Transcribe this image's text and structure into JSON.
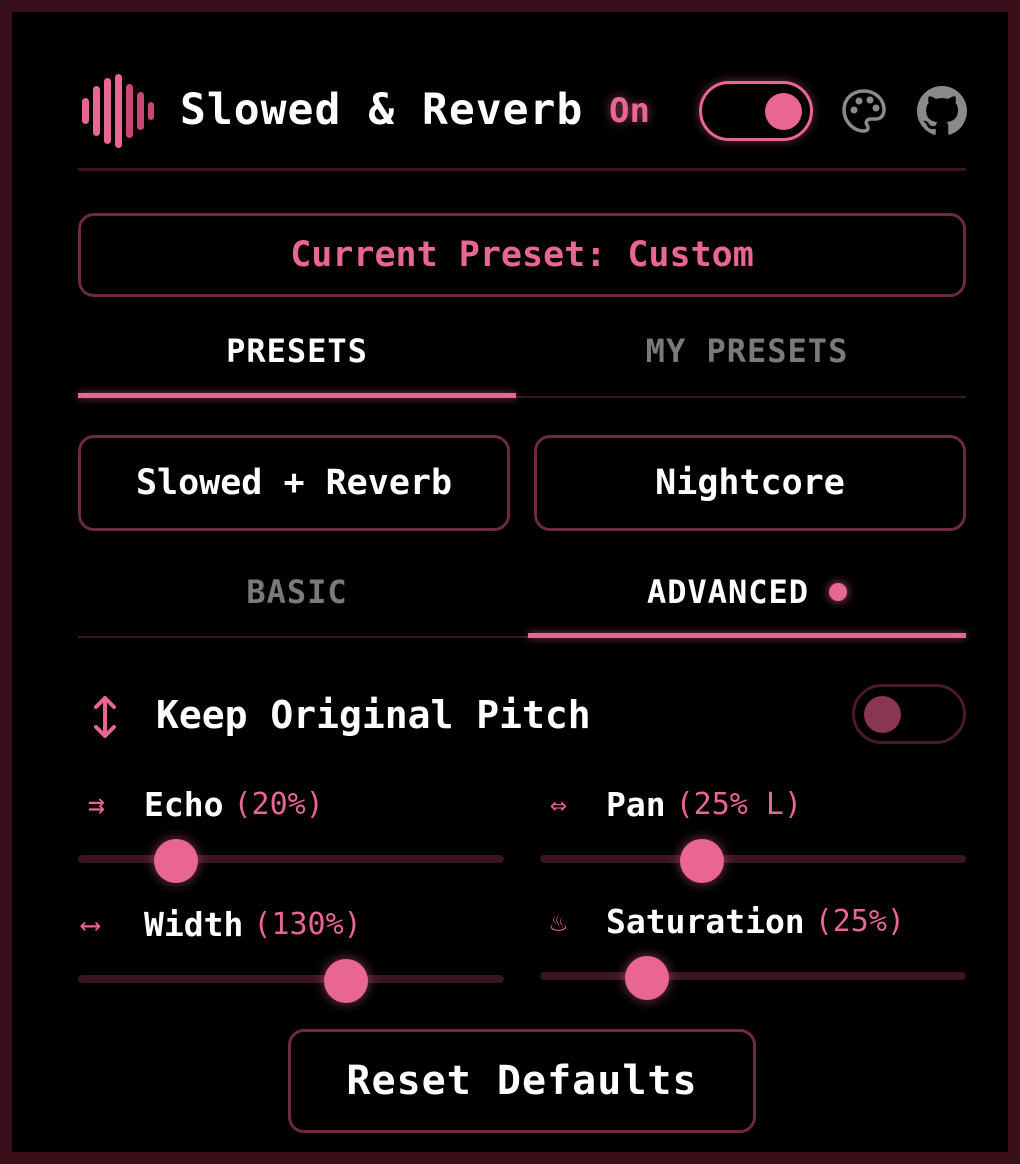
{
  "header": {
    "title": "Slowed & Reverb",
    "status": "On",
    "enabled": true,
    "icons": [
      "waveform-logo-icon",
      "palette-icon",
      "github-icon"
    ]
  },
  "current_preset": "Current Preset: Custom",
  "preset_tabs": [
    {
      "label": "PRESETS",
      "active": true
    },
    {
      "label": "MY PRESETS",
      "active": false
    }
  ],
  "presets": [
    {
      "label": "Slowed + Reverb"
    },
    {
      "label": "Nightcore"
    }
  ],
  "mode_tabs": [
    {
      "label": "BASIC",
      "active": false
    },
    {
      "label": "ADVANCED",
      "active": true
    }
  ],
  "keep_pitch": {
    "icon": "↕",
    "label": "Keep Original Pitch",
    "enabled": false
  },
  "sliders": [
    {
      "icon": "⇉",
      "name": "Echo",
      "value": "(20%)",
      "fraction": 0.23
    },
    {
      "icon": "⇔",
      "name": "Pan",
      "value": "(25% L)",
      "fraction": 0.38
    },
    {
      "icon": "⟷",
      "name": "Width",
      "value": "(130%)",
      "fraction": 0.63
    },
    {
      "icon": "♨",
      "name": "Saturation",
      "value": "(25%)",
      "fraction": 0.25
    }
  ],
  "reset_label": "Reset Defaults",
  "colors": {
    "accent": "#e8668f",
    "border": "#6d2a3f",
    "frame": "#3a0f1c",
    "background": "#000000"
  }
}
